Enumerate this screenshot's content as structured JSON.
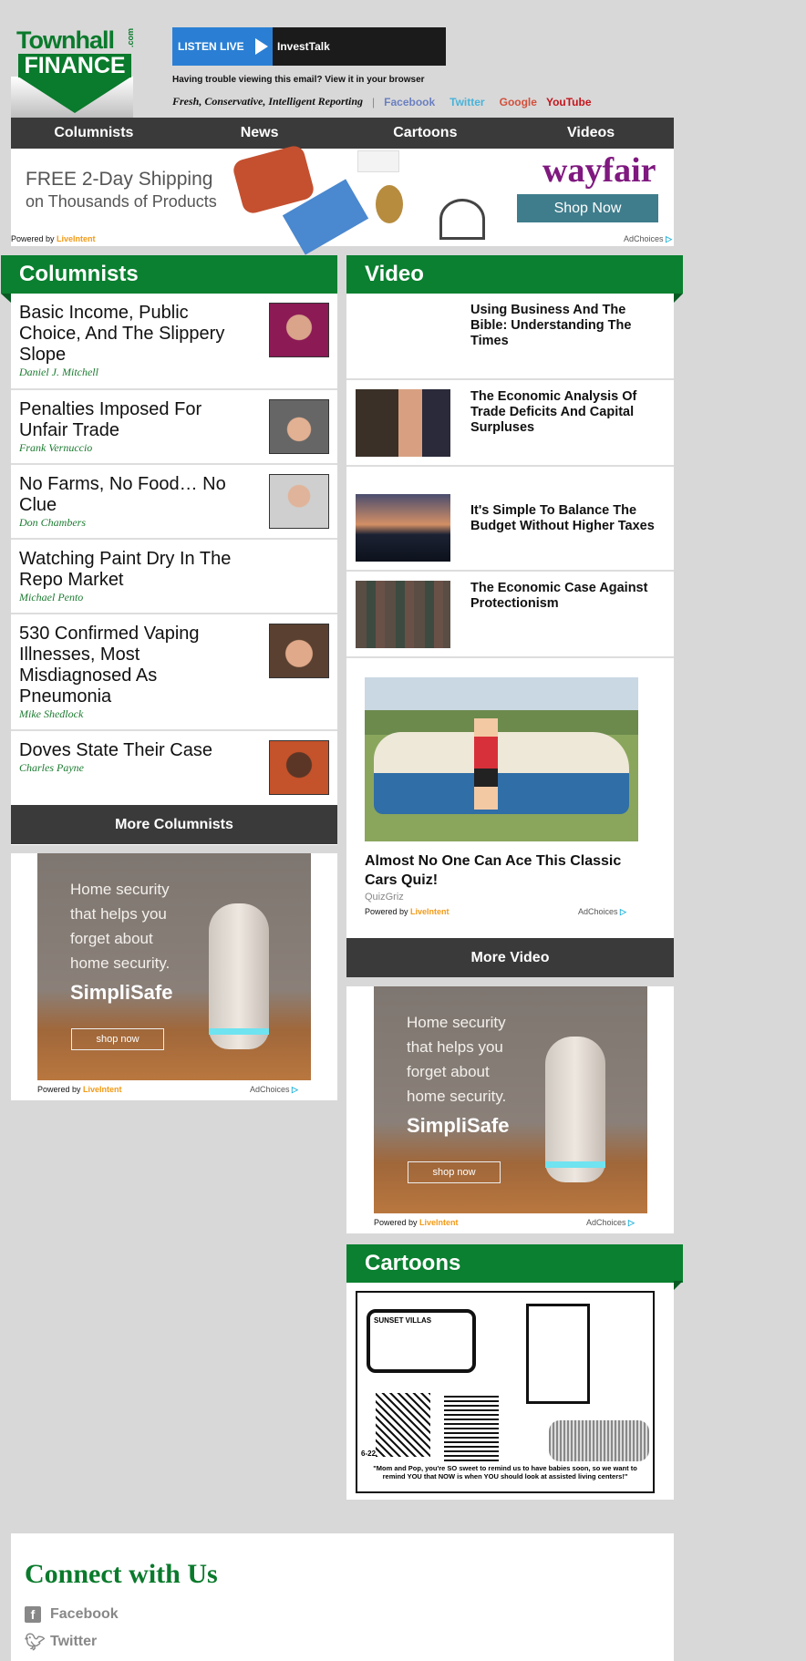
{
  "logo": {
    "brand": "Townhall",
    "com": ".com",
    "finance": "FINANCE"
  },
  "listen": {
    "label": "LISTEN LIVE",
    "station": "InvestTalk"
  },
  "trouble": "Having trouble viewing this email? View it in your browser",
  "tagline": "Fresh, Conservative, Intelligent Reporting",
  "social_links": [
    {
      "label": "Facebook",
      "color": "#6a7fc0"
    },
    {
      "label": "Twitter",
      "color": "#48b3d9"
    },
    {
      "label": "Google",
      "color": "#d2503c"
    },
    {
      "label": "YouTube",
      "color": "#c4151c"
    }
  ],
  "nav": [
    "Columnists",
    "News",
    "Cartoons",
    "Videos"
  ],
  "wayfair_ad": {
    "line1": "FREE 2-Day Shipping",
    "line2": "on Thousands of Products",
    "brand": "wayfair",
    "cta": "Shop Now"
  },
  "ad_common": {
    "powered": "Powered by",
    "liveintent": "LiveIntent",
    "adchoices": "AdChoices"
  },
  "columnists": {
    "title": "Columnists",
    "items": [
      {
        "headline": "Basic Income, Public Choice, And The Slippery Slope",
        "author": "Daniel J. Mitchell",
        "photo": true
      },
      {
        "headline": "Penalties Imposed For Unfair Trade",
        "author": "Frank Vernuccio",
        "photo": true
      },
      {
        "headline": "No Farms, No Food… No Clue",
        "author": "Don Chambers",
        "photo": true
      },
      {
        "headline": "Watching Paint Dry In The Repo Market",
        "author": "Michael Pento",
        "photo": false
      },
      {
        "headline": "530 Confirmed Vaping Illnesses, Most Misdiagnosed As Pneumonia",
        "author": "Mike Shedlock",
        "photo": true
      },
      {
        "headline": "Doves State Their Case",
        "author": "Charles Payne",
        "photo": true
      }
    ],
    "more": "More Columnists"
  },
  "video": {
    "title": "Video",
    "items": [
      {
        "headline": "Using Business And The Bible: Understanding The Times"
      },
      {
        "headline": "The Economic Analysis Of Trade Deficits And Capital Surpluses"
      },
      {
        "headline": "It's Simple To Balance The Budget Without Higher Taxes"
      },
      {
        "headline": "The Economic Case Against Protectionism"
      }
    ],
    "more": "More Video"
  },
  "quiz_ad": {
    "headline": "Almost No One Can Ace This Classic Cars Quiz!",
    "source": "QuizGriz"
  },
  "simplisafe_ad": {
    "l1": "Home security",
    "l2": "that helps you",
    "l3": "forget about",
    "l4": "home security.",
    "brand": "SimpliSafe",
    "cta": "shop now"
  },
  "cartoons": {
    "title": "Cartoons",
    "caption": "\"Mom and Pop, you're SO sweet to remind us to have babies soon, so we want to remind YOU that NOW is when YOU should look at assisted living centers!\"",
    "tv_text": "SUNSET VILLAS",
    "date": "6-22"
  },
  "connect": {
    "title": "Connect with Us",
    "links": [
      "Facebook",
      "Twitter"
    ]
  }
}
